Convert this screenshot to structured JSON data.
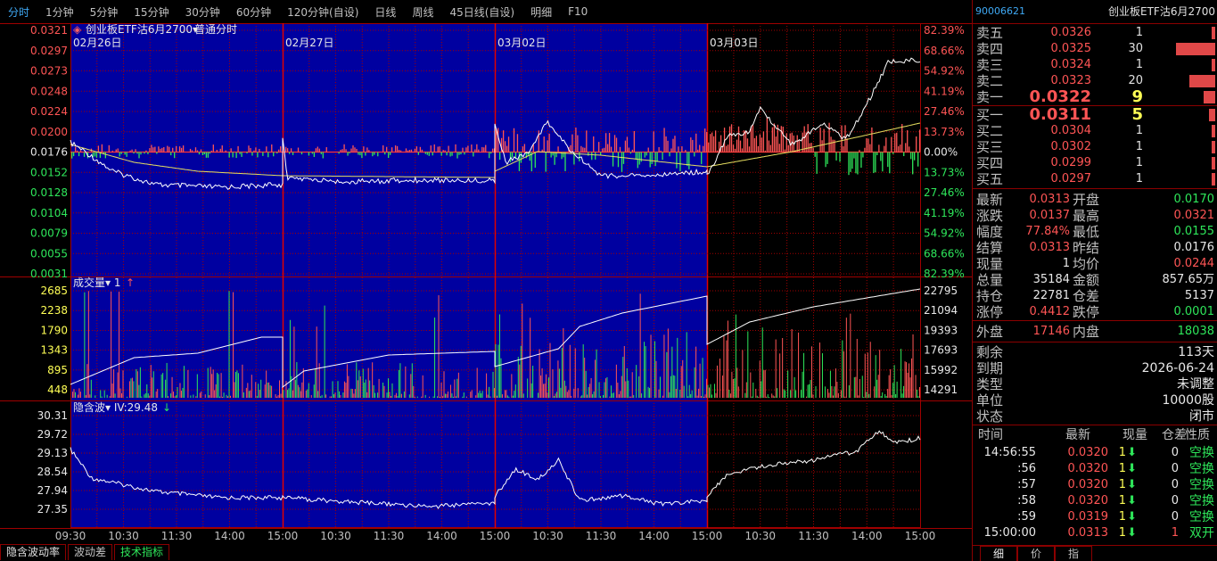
{
  "top_menu": [
    "分时",
    "1分钟",
    "5分钟",
    "15分钟",
    "30分钟",
    "60分钟",
    "120分钟(自设)",
    "日线",
    "周线",
    "45日线(自设)",
    "明细",
    "F10"
  ],
  "colors": {
    "panel_bg": "#0000a0",
    "grid": "#a00000",
    "price_up": "#ff5555",
    "price_down": "#2ee65a",
    "accent_blue": "#3fa9f5",
    "line_white": "#ffffff",
    "line_yellow": "#e8e060"
  },
  "chart": {
    "title_label": "创业板ETF沽6月2700",
    "title_arrow": "▾",
    "mode_label": "普通分时",
    "dates": [
      "02月26日",
      "02月27日",
      "03月02日",
      "03月03日"
    ],
    "left_price_ticks": [
      "0.0321",
      "0.0297",
      "0.0273",
      "0.0248",
      "0.0224",
      "0.0200",
      "0.0176",
      "0.0152",
      "0.0128",
      "0.0104",
      "0.0079",
      "0.0055",
      "0.0031"
    ],
    "right_pct_ticks": [
      "82.39%",
      "68.66%",
      "54.92%",
      "41.19%",
      "27.46%",
      "13.73%",
      "0.00%",
      "13.73%",
      "27.46%",
      "41.19%",
      "54.92%",
      "68.66%",
      "82.39%"
    ],
    "volume_label": "成交量",
    "volume_arrow": "▾",
    "volume_multiplier": "1",
    "volume_trend": "↑",
    "volume_left_ticks": [
      "2685",
      "2238",
      "1790",
      "1343",
      "895",
      "448"
    ],
    "volume_right_ticks": [
      "22795",
      "21094",
      "19393",
      "17693",
      "15992",
      "14291"
    ],
    "iv_label": "隐含波",
    "iv_arrow": "▾",
    "iv_value": "IV:29.48",
    "iv_trend": "↓",
    "iv_left_ticks": [
      "30.31",
      "29.72",
      "29.13",
      "28.54",
      "27.94",
      "27.35"
    ],
    "time_ticks": [
      "09:30",
      "10:30",
      "11:30",
      "14:00",
      "15:00",
      "10:30",
      "11:30",
      "14:00",
      "15:00",
      "10:30",
      "11:30",
      "14:00",
      "15:00",
      "10:30",
      "11:30",
      "14:00",
      "15:00"
    ]
  },
  "bottom_tabs": [
    "隐含波动率",
    "波动差",
    "技术指标"
  ],
  "right_panel": {
    "code": "90006621",
    "name": "创业板ETF沽6月2700",
    "asks": [
      {
        "label": "卖五",
        "price": "0.0326",
        "vol": "1",
        "bar": 1
      },
      {
        "label": "卖四",
        "price": "0.0325",
        "vol": "30",
        "bar": 30
      },
      {
        "label": "卖三",
        "price": "0.0324",
        "vol": "1",
        "bar": 1
      },
      {
        "label": "卖二",
        "price": "0.0323",
        "vol": "20",
        "bar": 20
      },
      {
        "label": "卖一",
        "price": "0.0322",
        "vol": "9",
        "bar": 9
      }
    ],
    "bids": [
      {
        "label": "买一",
        "price": "0.0311",
        "vol": "5",
        "bar": 5
      },
      {
        "label": "买二",
        "price": "0.0304",
        "vol": "1",
        "bar": 1
      },
      {
        "label": "买三",
        "price": "0.0302",
        "vol": "1",
        "bar": 1
      },
      {
        "label": "买四",
        "price": "0.0299",
        "vol": "1",
        "bar": 1
      },
      {
        "label": "买五",
        "price": "0.0297",
        "vol": "1",
        "bar": 1
      }
    ],
    "quote": [
      {
        "l1": "最新",
        "v1": "0.0313",
        "c1": "red",
        "l2": "开盘",
        "v2": "0.0170",
        "c2": "green"
      },
      {
        "l1": "涨跌",
        "v1": "0.0137",
        "c1": "red",
        "l2": "最高",
        "v2": "0.0321",
        "c2": "red"
      },
      {
        "l1": "幅度",
        "v1": "77.84%",
        "c1": "red",
        "l2": "最低",
        "v2": "0.0155",
        "c2": "green"
      },
      {
        "l1": "结算",
        "v1": "0.0313",
        "c1": "red",
        "l2": "昨结",
        "v2": "0.0176",
        "c2": "white"
      },
      {
        "l1": "现量",
        "v1": "1",
        "c1": "white",
        "l2": "均价",
        "v2": "0.0244",
        "c2": "red"
      },
      {
        "l1": "总量",
        "v1": "35184",
        "c1": "white",
        "l2": "金额",
        "v2": "857.65万",
        "c2": "white"
      },
      {
        "l1": "持仓",
        "v1": "22781",
        "c1": "white",
        "l2": "仓差",
        "v2": "5137",
        "c2": "white"
      },
      {
        "l1": "涨停",
        "v1": "0.4412",
        "c1": "red",
        "l2": "跌停",
        "v2": "0.0001",
        "c2": "green"
      }
    ],
    "outer": {
      "l1": "外盘",
      "v1": "17146",
      "l2": "内盘",
      "v2": "18038"
    },
    "info": [
      {
        "l": "剩余",
        "v": "113天"
      },
      {
        "l": "到期",
        "v": "2026-06-24"
      },
      {
        "l": "类型",
        "v": "未调整"
      },
      {
        "l": "单位",
        "v": "10000股"
      },
      {
        "l": "状态",
        "v": "闭市"
      }
    ],
    "trade_headers": [
      "时间",
      "最新",
      "现量",
      "仓差",
      "性质"
    ],
    "trades": [
      {
        "time": "14:56:55",
        "price": "0.0320",
        "vol": "1",
        "arrow": "⬇",
        "diff": "0",
        "nature": "空换",
        "dc": "white"
      },
      {
        "time": ":56",
        "price": "0.0320",
        "vol": "1",
        "arrow": "⬇",
        "diff": "0",
        "nature": "空换",
        "dc": "white"
      },
      {
        "time": ":57",
        "price": "0.0320",
        "vol": "1",
        "arrow": "⬇",
        "diff": "0",
        "nature": "空换",
        "dc": "white"
      },
      {
        "time": ":58",
        "price": "0.0320",
        "vol": "1",
        "arrow": "⬇",
        "diff": "0",
        "nature": "空换",
        "dc": "white"
      },
      {
        "time": ":59",
        "price": "0.0319",
        "vol": "1",
        "arrow": "⬇",
        "diff": "0",
        "nature": "空换",
        "dc": "white"
      },
      {
        "time": "15:00:00",
        "price": "0.0313",
        "vol": "1",
        "arrow": "⬇",
        "diff": "1",
        "nature": "双开",
        "dc": "red"
      }
    ],
    "tabs": [
      "细",
      "价",
      "指"
    ]
  }
}
